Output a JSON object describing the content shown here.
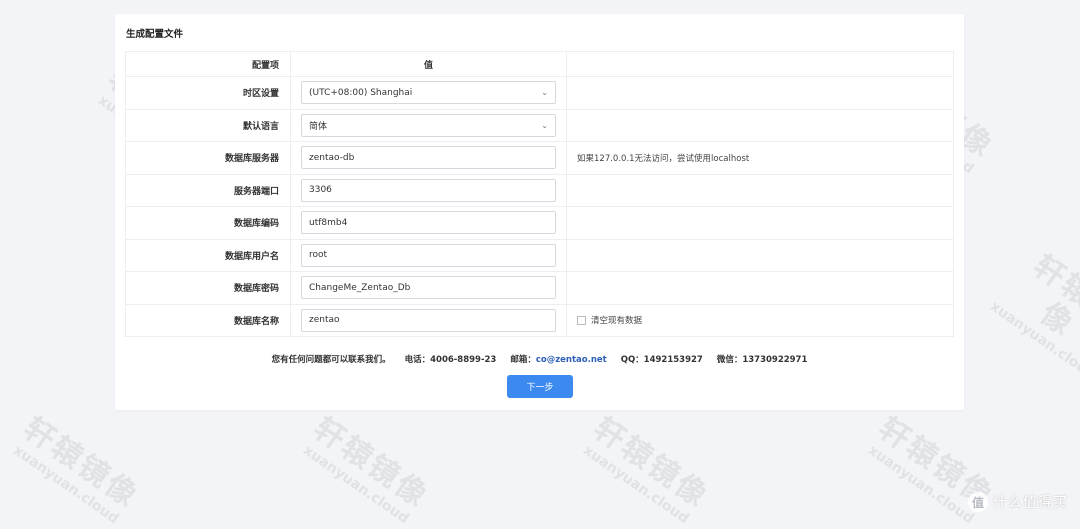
{
  "watermark": {
    "cn": "轩辕镜像",
    "en": "xuanyuan.cloud"
  },
  "card": {
    "title": "生成配置文件"
  },
  "table": {
    "headers": [
      "配置项",
      "值",
      ""
    ],
    "rows": [
      {
        "label": "时区设置",
        "value": "(UTC+08:00) Shanghai",
        "type": "select",
        "note": ""
      },
      {
        "label": "默认语言",
        "value": "简体",
        "type": "select",
        "note": ""
      },
      {
        "label": "数据库服务器",
        "value": "zentao-db",
        "type": "input",
        "note": "如果127.0.0.1无法访问，尝试使用localhost"
      },
      {
        "label": "服务器端口",
        "value": "3306",
        "type": "input",
        "note": ""
      },
      {
        "label": "数据库编码",
        "value": "utf8mb4",
        "type": "input",
        "note": ""
      },
      {
        "label": "数据库用户名",
        "value": "root",
        "type": "input",
        "note": ""
      },
      {
        "label": "数据库密码",
        "value": "ChangeMe_Zentao_Db",
        "type": "input",
        "note": ""
      },
      {
        "label": "数据库名称",
        "value": "zentao",
        "type": "input",
        "note": ""
      }
    ],
    "clear_checkbox_label": "清空现有数据"
  },
  "contact": {
    "intro": "您有任何问题都可以联系我们。",
    "phone": "电话：4006-8899-23",
    "email_label": "邮箱：",
    "email": "co@zentao.net",
    "qq": "QQ：1492153927",
    "wechat": "微信：13730922971"
  },
  "next_button": "下一步",
  "brand": {
    "logo": "值",
    "text": "什么值得买"
  },
  "icons": {
    "select_arrow": "chevron-down-icon",
    "checkbox": "checkbox-icon"
  }
}
